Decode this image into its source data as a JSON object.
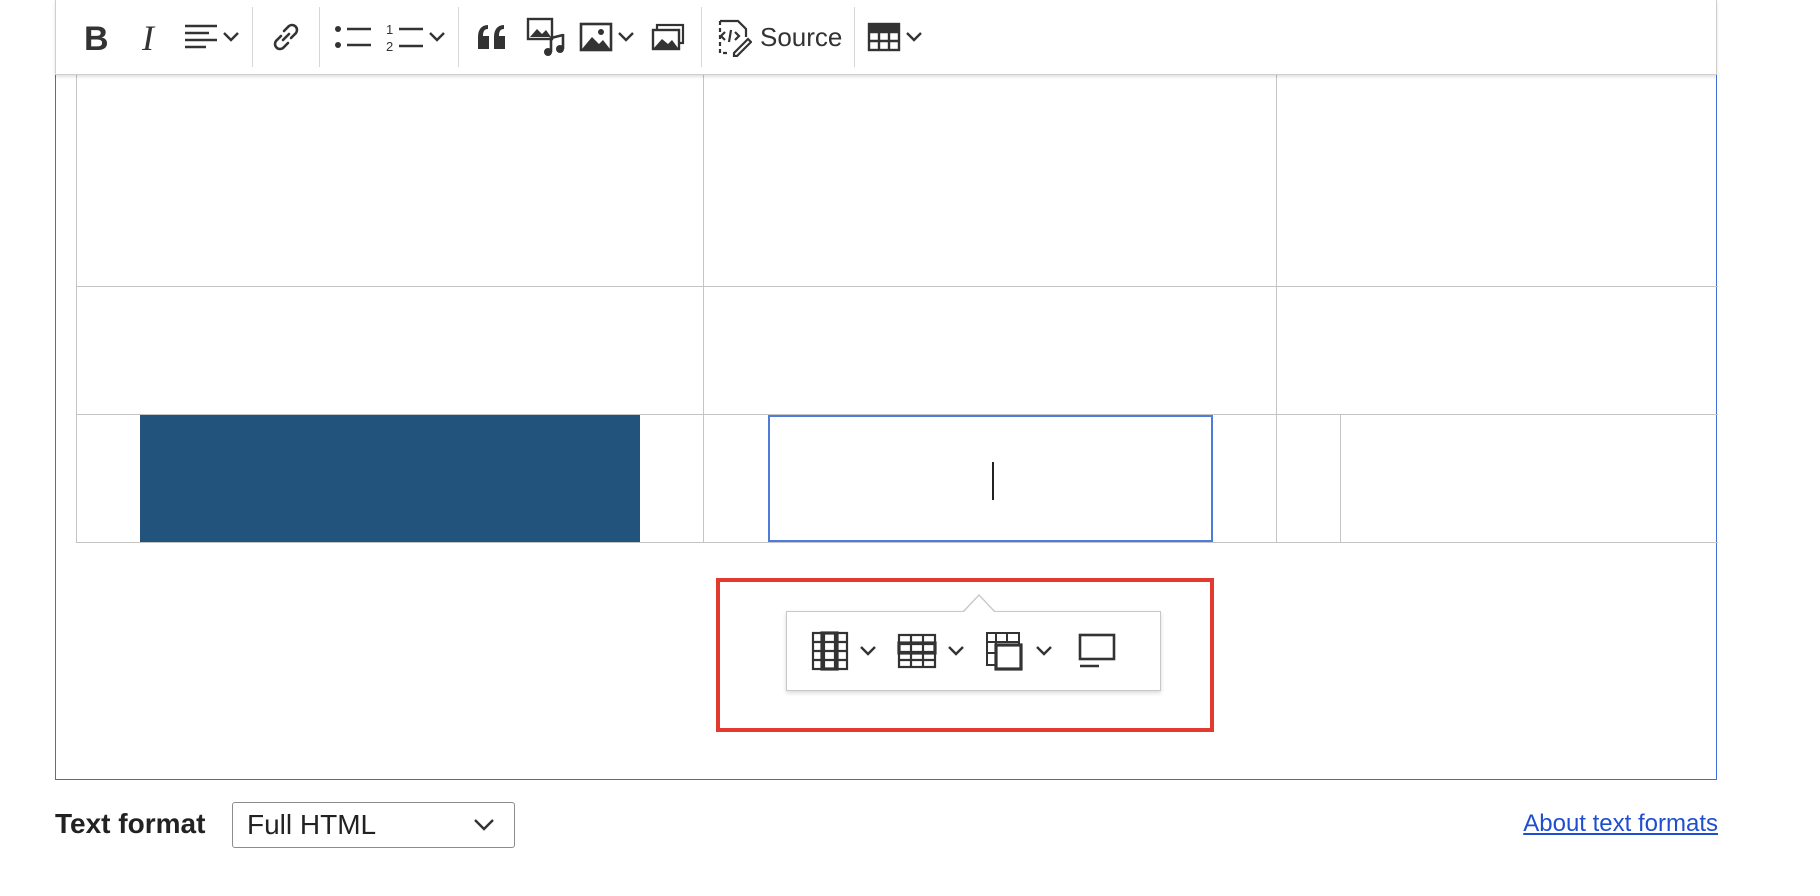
{
  "toolbar": {
    "items": [
      {
        "name": "bold-button",
        "icon": "bold-icon"
      },
      {
        "name": "italic-button",
        "icon": "italic-icon"
      },
      {
        "name": "align-button",
        "icon": "align-left-icon"
      },
      {
        "name": "link-button",
        "icon": "link-icon"
      },
      {
        "name": "bulleted-list-button",
        "icon": "bulleted-list-icon"
      },
      {
        "name": "numbered-list-button",
        "icon": "numbered-list-icon"
      },
      {
        "name": "blockquote-button",
        "icon": "quote-icon"
      },
      {
        "name": "media-button",
        "icon": "media-icon"
      },
      {
        "name": "image-button",
        "icon": "image-icon"
      },
      {
        "name": "media-library-button",
        "icon": "media-library-icon"
      },
      {
        "name": "source-button",
        "icon": "source-icon"
      },
      {
        "name": "insert-table-button",
        "icon": "table-icon"
      }
    ],
    "source_label": "Source"
  },
  "table": {
    "rows": 3,
    "columns": 3,
    "selected_cell_color": "#4f7bd9",
    "filled_block_color": "#22537d"
  },
  "table_toolbar": {
    "items": [
      {
        "name": "table-column-button",
        "icon": "table-column-icon"
      },
      {
        "name": "table-row-button",
        "icon": "table-row-icon"
      },
      {
        "name": "merge-cells-button",
        "icon": "merge-cells-icon"
      },
      {
        "name": "table-caption-button",
        "icon": "table-caption-icon"
      }
    ],
    "highlight_color": "#e33a2f"
  },
  "footer": {
    "text_format_label": "Text format",
    "text_format_value": "Full HTML",
    "help_link": "About text formats"
  }
}
